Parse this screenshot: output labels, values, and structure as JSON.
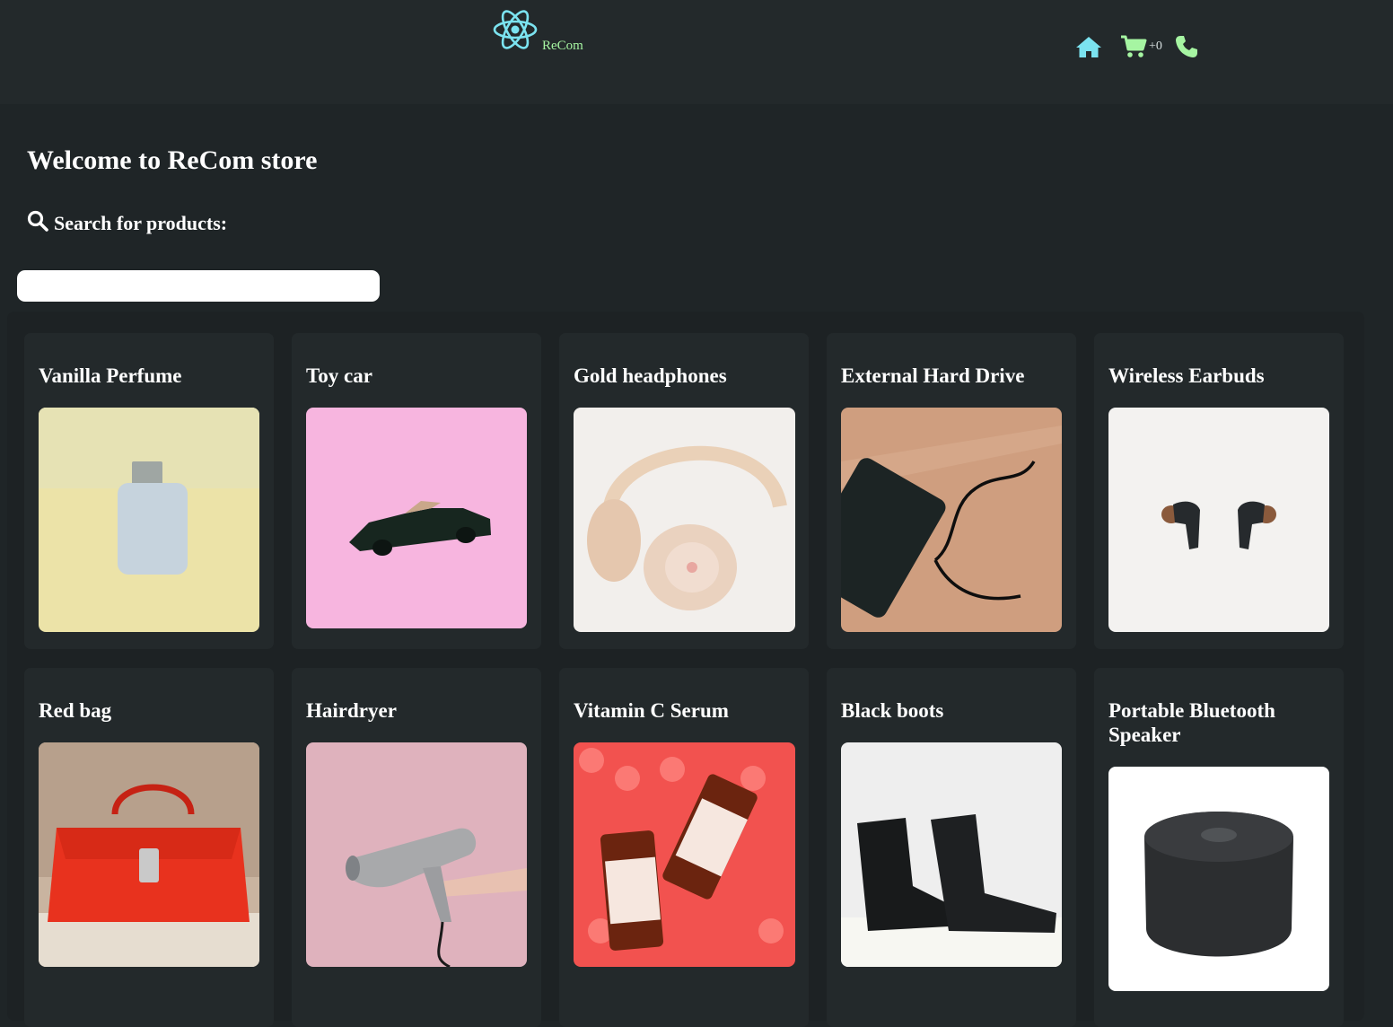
{
  "navbar": {
    "brand": "ReCom",
    "cart_count": "+0",
    "icons": [
      "react-logo-icon",
      "home-icon",
      "cart-icon",
      "phone-icon"
    ],
    "colors": {
      "logo": "#7be3f0",
      "brand_text": "#a6f5a2",
      "home": "#7be3f0",
      "cart": "#a6f5a2",
      "phone": "#a6f5a2"
    }
  },
  "hero": {
    "title": "Welcome to ReCom store",
    "search_label": "Search for products:",
    "search_value": ""
  },
  "products": [
    {
      "name": "Vanilla Perfume"
    },
    {
      "name": "Toy car"
    },
    {
      "name": "Gold headphones"
    },
    {
      "name": "External Hard Drive"
    },
    {
      "name": "Wireless Earbuds"
    },
    {
      "name": "Red bag"
    },
    {
      "name": "Hairdryer"
    },
    {
      "name": "Vitamin C Serum"
    },
    {
      "name": "Black boots"
    },
    {
      "name": "Portable Bluetooth Speaker"
    }
  ]
}
